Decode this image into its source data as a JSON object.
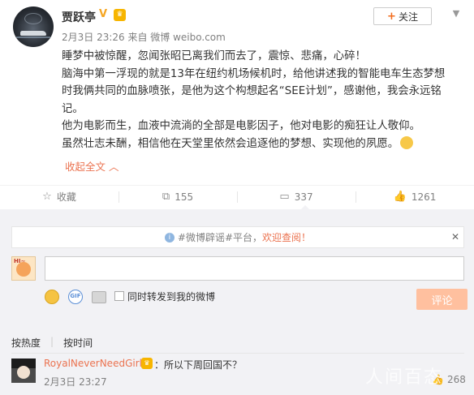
{
  "post": {
    "author": "贾跃亭",
    "meta": "2月3日 23:26 来自 微博 weibo.com",
    "follow_label": "关注",
    "paragraphs": [
      "睡梦中被惊醒，忽闻张昭已离我们而去了，震惊、悲痛，心碎！",
      "脑海中第一浮现的就是13年在纽约机场候机时，给他讲述我的智能电车生态梦想时我俩共同的血脉喷张，是他为这个构想起名“SEE计划”，感谢他，我会永远铭记。",
      "他为电影而生，血液中流淌的全部是电影因子，他对电影的痴狂让人敬仰。",
      "虽然壮志未酬，相信他在天堂里依然会追逐他的梦想、实现他的夙愿。"
    ],
    "collapse_label": "收起全文 ︿"
  },
  "actions": {
    "favorite": "收藏",
    "repost": "155",
    "comment": "337",
    "like": "1261"
  },
  "comment_box": {
    "notice_prefix": "#微博辟谣#平台，",
    "notice_link": "欢迎查阅！",
    "repost_checkbox_label": "同时转发到我的微博",
    "submit_label": "评论"
  },
  "sort": {
    "by_hot": "按热度",
    "by_time": "按时间"
  },
  "comments": [
    {
      "user": "RoyalNeverNeedGirls",
      "text": "：所以下周回国不？",
      "time": "2月3日 23:27",
      "likes": "268"
    }
  ],
  "watermark": "人间百态",
  "colors": {
    "accent": "#eb7350",
    "muted": "#808080",
    "comment_bg": "#f2f2f5",
    "submit_disabled": "#ffc09f"
  },
  "icons": [
    "chevron-down-icon",
    "plus-icon",
    "star-icon",
    "repost-icon",
    "comment-icon",
    "thumbs-up-icon",
    "info-icon",
    "close-icon",
    "emoji-icon",
    "gif-icon",
    "image-icon"
  ]
}
